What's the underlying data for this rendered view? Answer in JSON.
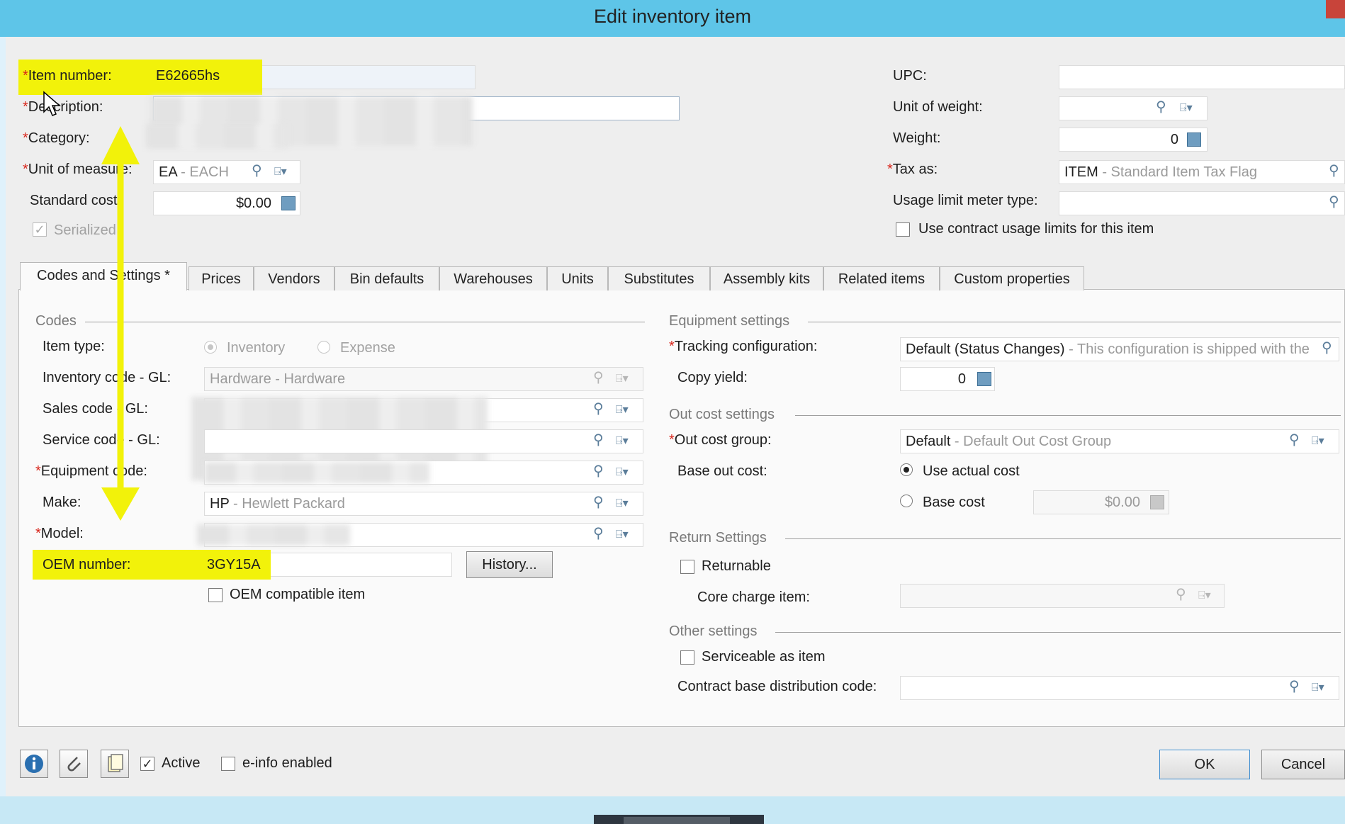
{
  "window": {
    "title": "Edit inventory item"
  },
  "header_left": {
    "item_number": {
      "label": "Item number:",
      "value": "E62665hs"
    },
    "description": {
      "label": "Description:"
    },
    "category": {
      "label": "Category:"
    },
    "unit_of_measure": {
      "label": "Unit of measure:",
      "code": "EA",
      "desc": " - EACH"
    },
    "standard_cost": {
      "label": "Standard cost:",
      "value": "$0.00"
    },
    "serialized": {
      "label": "Serialized",
      "checked": true
    }
  },
  "header_right": {
    "upc": {
      "label": "UPC:",
      "value": ""
    },
    "unit_of_weight": {
      "label": "Unit of weight:",
      "value": ""
    },
    "weight": {
      "label": "Weight:",
      "value": "0"
    },
    "tax_as": {
      "label": "Tax as:",
      "code": "ITEM",
      "desc": " - Standard Item Tax Flag"
    },
    "usage_limit_meter_type": {
      "label": "Usage limit meter type:",
      "value": ""
    },
    "use_contract_usage": {
      "label": "Use contract usage limits for this item",
      "checked": false
    }
  },
  "tabs": [
    "Codes and Settings *",
    "Prices",
    "Vendors",
    "Bin defaults",
    "Warehouses",
    "Units",
    "Substitutes",
    "Assembly kits",
    "Related items",
    "Custom properties"
  ],
  "codes": {
    "section": "Codes",
    "item_type": {
      "label": "Item type:",
      "options": [
        "Inventory",
        "Expense"
      ],
      "selected": "Inventory"
    },
    "inventory_code_gl": {
      "label": "Inventory code - GL:",
      "code": "Hardware",
      "desc": " - Hardware"
    },
    "sales_code_gl": {
      "label": "Sales code - GL:"
    },
    "service_code_gl": {
      "label": "Service code - GL:"
    },
    "equipment_code": {
      "label": "Equipment code:"
    },
    "make": {
      "label": "Make:",
      "code": "HP",
      "desc": " - Hewlett Packard"
    },
    "model": {
      "label": "Model:"
    },
    "oem_number": {
      "label": "OEM number:",
      "value": "3GY15A"
    },
    "history_button": "History...",
    "oem_compatible": {
      "label": "OEM compatible item",
      "checked": false
    }
  },
  "equipment_settings": {
    "section": "Equipment settings",
    "tracking_configuration": {
      "label": "Tracking configuration:",
      "code": "Default (Status Changes)",
      "desc": " - This configuration is shipped with the"
    },
    "copy_yield": {
      "label": "Copy yield:",
      "value": "0"
    }
  },
  "out_cost_settings": {
    "section": "Out cost settings",
    "out_cost_group": {
      "label": "Out cost group:",
      "code": "Default",
      "desc": " - Default Out Cost Group"
    },
    "base_out_cost": {
      "label": "Base out cost:",
      "use_actual": "Use actual cost",
      "base_cost": "Base cost",
      "selected": "Use actual cost",
      "base_cost_value": "$0.00"
    }
  },
  "return_settings": {
    "section": "Return Settings",
    "returnable": {
      "label": "Returnable",
      "checked": false
    },
    "core_charge_item": {
      "label": "Core charge item:"
    }
  },
  "other_settings": {
    "section": "Other settings",
    "serviceable": {
      "label": "Serviceable as item",
      "checked": false
    },
    "contract_base_distribution_code": {
      "label": "Contract base distribution code:"
    }
  },
  "footer": {
    "active": {
      "label": "Active",
      "checked": true
    },
    "einfo": {
      "label": "e-info enabled",
      "checked": false
    },
    "ok": "OK",
    "cancel": "Cancel"
  },
  "annotation_color": "#f2f20a",
  "glyphs": {
    "required": "*",
    "magnifier": "⚲",
    "lookup": "⍈▾",
    "check": "✓"
  }
}
